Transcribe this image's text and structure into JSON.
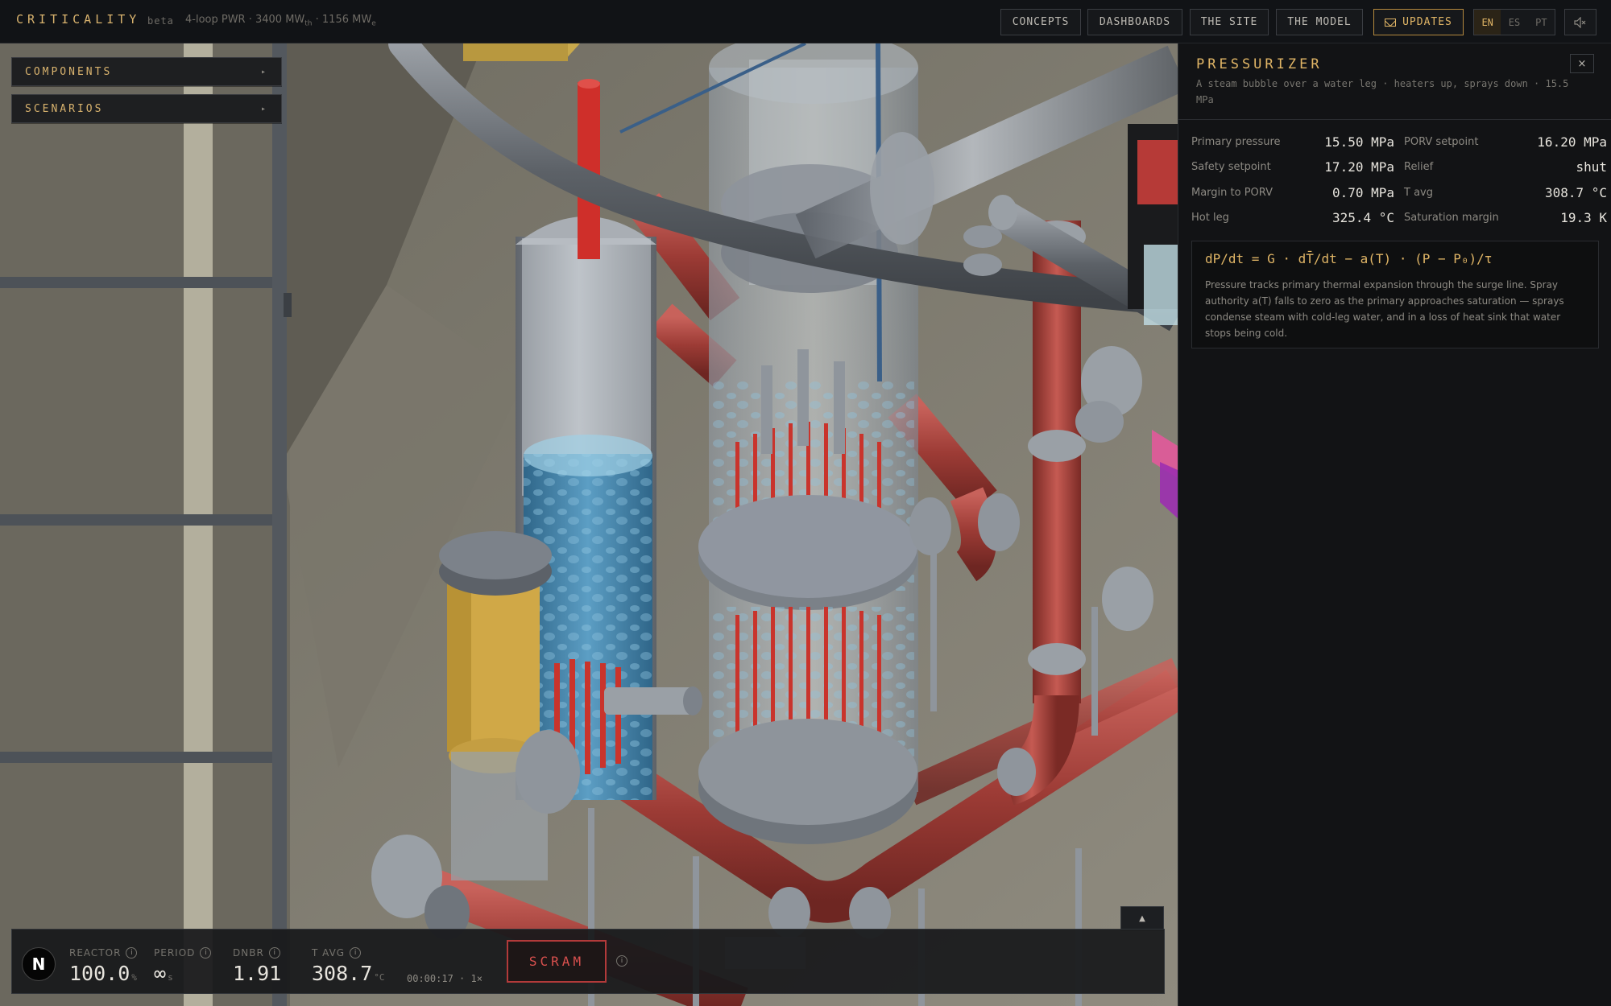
{
  "header": {
    "brand": "CRITICALITY",
    "badge": "beta",
    "spec_main": "4-loop PWR · 3400 MW",
    "spec_sub1": "th",
    "spec_mid": " · 1156 MW",
    "spec_sub2": "e",
    "nav": [
      "CONCEPTS",
      "DASHBOARDS",
      "THE SITE",
      "THE MODEL"
    ],
    "updates_label": "UPDATES",
    "languages": [
      "EN",
      "ES",
      "PT"
    ],
    "active_language": "EN",
    "accent": "#e0b566"
  },
  "sidebar": {
    "components_label": "COMPONENTS",
    "scenarios_label": "SCENARIOS",
    "arrow": "▸"
  },
  "status": {
    "logo": "N",
    "reactor": {
      "label": "REACTOR",
      "value": "100.0",
      "unit": "%"
    },
    "period": {
      "label": "PERIOD",
      "value": "∞",
      "unit": "s"
    },
    "dnbr": {
      "label": "DNBR",
      "value": "1.91"
    },
    "tavg": {
      "label": "T AVG",
      "value": "308.7",
      "unit": "°C"
    },
    "clock": "00:00:17 · 1×",
    "scram_label": "SCRAM",
    "info_glyph": "i",
    "expand_glyph": "▲"
  },
  "panel": {
    "title": "PRESSURIZER",
    "close_glyph": "×",
    "subtitle": "A steam bubble over a water leg · heaters up, sprays down · 15.5 MPa",
    "stats": [
      {
        "key": "Primary pressure",
        "value": "15.50 MPa"
      },
      {
        "key": "PORV setpoint",
        "value": "16.20 MPa"
      },
      {
        "key": "Safety setpoint",
        "value": "17.20 MPa"
      },
      {
        "key": "Relief",
        "value": "shut"
      },
      {
        "key": "Margin to PORV",
        "value": "0.70 MPa"
      },
      {
        "key": "T avg",
        "value": "308.7 °C"
      },
      {
        "key": "Hot leg",
        "value": "325.4 °C"
      },
      {
        "key": "Saturation margin",
        "value": "19.3 K"
      }
    ],
    "formula": "dP/dt = G · dT̄/dt − a(T) · (P − P₀)/τ",
    "explanation": "Pressure tracks primary thermal expansion through the surge line. Spray authority a(T) falls to zero as the primary approaches saturation — sprays condense steam with cold-leg water, and in a loss of heat sink that water stops being cold."
  },
  "scene": {
    "hot_leg_color": "#a8423c",
    "water_color": "#3f7fa6",
    "steel_color": "#8e949b",
    "heater_color": "#c9342c"
  }
}
